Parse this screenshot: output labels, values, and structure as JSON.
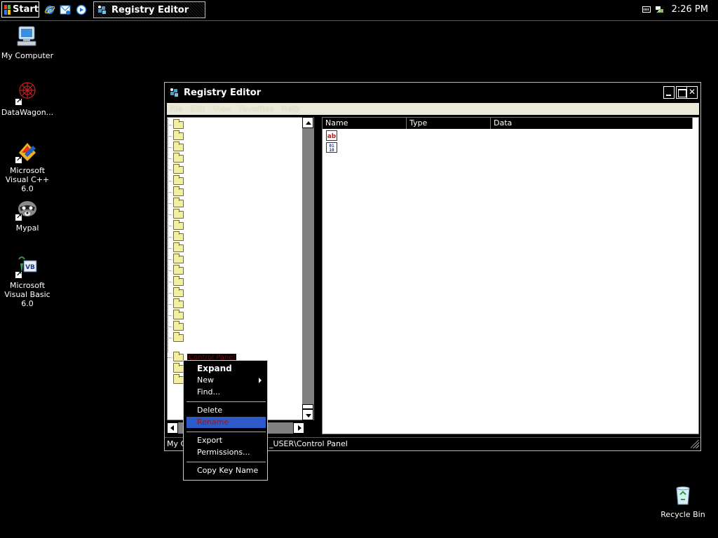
{
  "taskbar": {
    "start_label": "Start",
    "quicklaunch": [
      "internet-explorer-icon",
      "outlook-express-icon",
      "media-player-icon"
    ],
    "task_button_label": "Registry Editor",
    "clock": "2:26 PM"
  },
  "desktop": {
    "icons": [
      {
        "label": "My Computer",
        "icon": "my-computer-icon"
      },
      {
        "label": "DataWagon...",
        "icon": "datawagon-icon"
      },
      {
        "label": "Microsoft Visual C++ 6.0",
        "icon": "visual-cpp-icon"
      },
      {
        "label": "Mypal",
        "icon": "mypal-icon"
      },
      {
        "label": "Microsoft Visual Basic 6.0",
        "icon": "visual-basic-icon"
      },
      {
        "label": "Recycle Bin",
        "icon": "recycle-bin-icon"
      }
    ]
  },
  "window": {
    "title": "Registry Editor",
    "menu": [
      "File",
      "Edit",
      "View",
      "Favorites",
      "Help"
    ],
    "tree": {
      "folder_count": 21,
      "selected_label": "Control Panel"
    },
    "columns": [
      "Name",
      "Type",
      "Data"
    ],
    "values": [
      {
        "icon": "string-value-icon"
      },
      {
        "icon": "binary-value-icon"
      }
    ],
    "status_left": "My C",
    "status_right": "_USER\\Control Panel"
  },
  "context_menu": {
    "items": [
      {
        "label": "Expand",
        "bold": true
      },
      {
        "label": "New",
        "submenu": true
      },
      {
        "label": "Find..."
      },
      {
        "label": "Delete"
      },
      {
        "label": "Rename",
        "highlighted": true
      },
      {
        "label": "Export"
      },
      {
        "label": "Permissions..."
      },
      {
        "label": "Copy Key Name"
      }
    ]
  },
  "colors": {
    "highlight": "#2d5ac8",
    "menubar": "#ece9d8",
    "folder": "#f4eea0"
  }
}
